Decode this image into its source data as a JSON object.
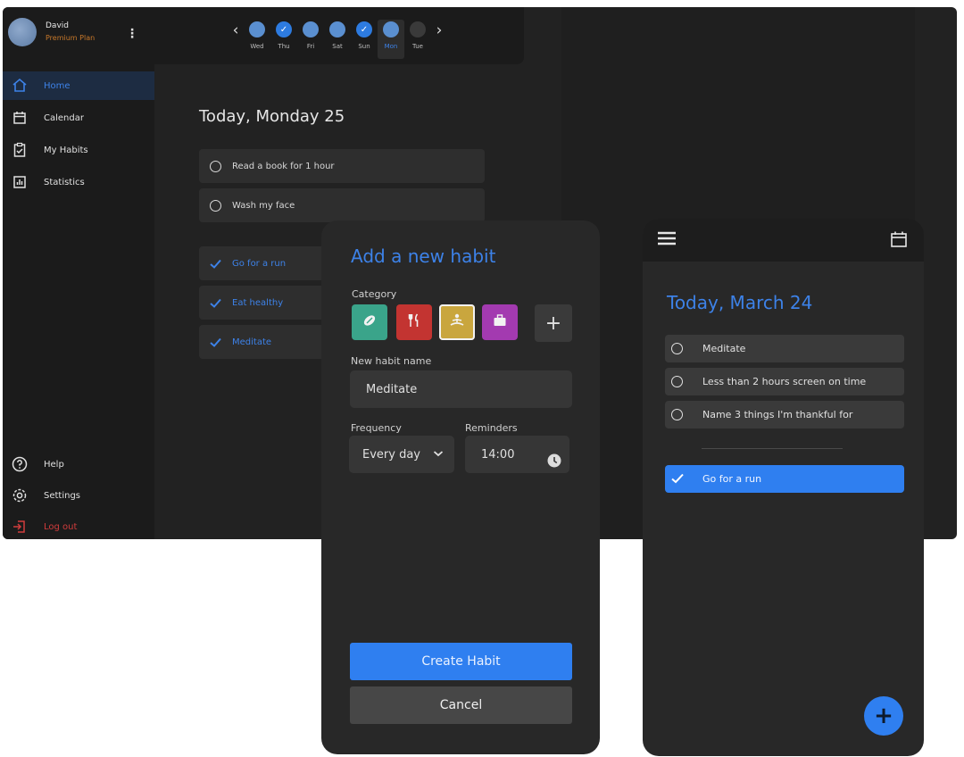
{
  "desktop": {
    "profile": {
      "name": "David",
      "plan": "Premium Plan"
    },
    "week": {
      "days": [
        {
          "label": "Wed",
          "state": "filled"
        },
        {
          "label": "Thu",
          "state": "checked"
        },
        {
          "label": "Fri",
          "state": "filled"
        },
        {
          "label": "Sat",
          "state": "filled"
        },
        {
          "label": "Sun",
          "state": "checked"
        },
        {
          "label": "Mon",
          "state": "selected"
        },
        {
          "label": "Tue",
          "state": "empty"
        }
      ]
    },
    "nav": {
      "home": "Home",
      "calendar": "Calendar",
      "habits": "My Habits",
      "statistics": "Statistics",
      "help": "Help",
      "settings": "Settings",
      "logout": "Log out"
    },
    "title": "Today, Monday 25",
    "pending": [
      "Read a book for 1 hour",
      "Wash my face"
    ],
    "completed": [
      "Go for a run",
      "Eat healthy",
      "Meditate"
    ]
  },
  "modal": {
    "title": "Add a new habit",
    "category_label": "Category",
    "categories": [
      {
        "icon": "sport-icon",
        "color": "#3aa48a"
      },
      {
        "icon": "food-icon",
        "color": "#c33431"
      },
      {
        "icon": "meditation-icon",
        "color": "#c9a63e"
      },
      {
        "icon": "work-icon",
        "color": "#a33ab0"
      }
    ],
    "name_label": "New habit name",
    "name_value": "Meditate",
    "frequency_label": "Frequency",
    "frequency_value": "Every day",
    "reminders_label": "Reminders",
    "reminders_value": "14:00",
    "create_label": "Create Habit",
    "cancel_label": "Cancel"
  },
  "mobile": {
    "title": "Today, March 24",
    "pending": [
      "Meditate",
      "Less than 2 hours screen on time",
      "Name 3 things I'm thankful for"
    ],
    "completed": [
      "Go for a run"
    ]
  },
  "colors": {
    "accent": "#2f7ff0",
    "plan": "#c7782a",
    "logout": "#d13c3c"
  }
}
